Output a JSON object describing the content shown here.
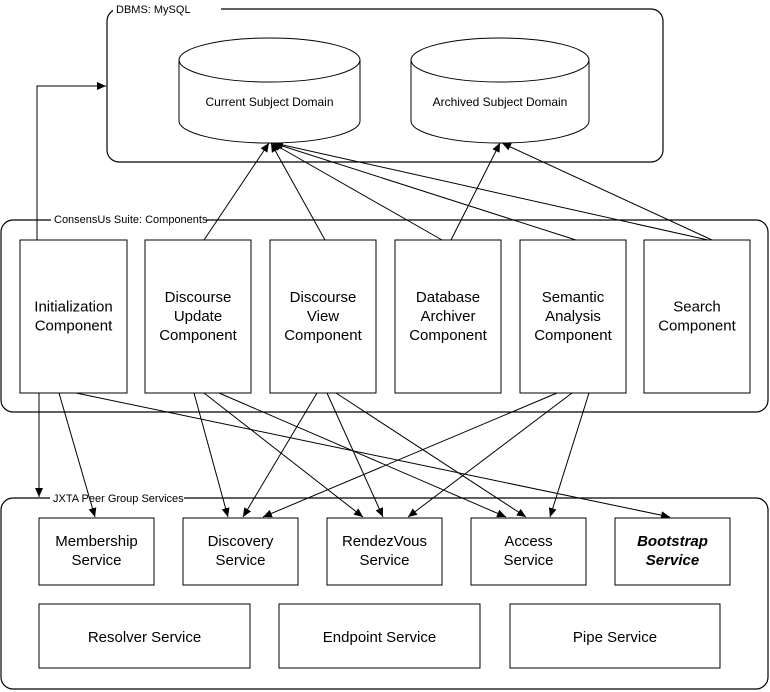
{
  "groups": {
    "dbms": "DBMS: MySQL",
    "components": "ConsensUs Suite: Components",
    "services": "JXTA Peer Group Services"
  },
  "databases": [
    {
      "id": "current",
      "label": "Current Subject Domain"
    },
    {
      "id": "archived",
      "label": "Archived Subject Domain"
    }
  ],
  "components": [
    {
      "id": "init",
      "lines": [
        "Initialization",
        "Component"
      ]
    },
    {
      "id": "du",
      "lines": [
        "Discourse",
        "Update",
        "Component"
      ]
    },
    {
      "id": "dv",
      "lines": [
        "Discourse",
        "View",
        "Component"
      ]
    },
    {
      "id": "da",
      "lines": [
        "Database",
        "Archiver",
        "Component"
      ]
    },
    {
      "id": "sa",
      "lines": [
        "Semantic",
        "Analysis",
        "Component"
      ]
    },
    {
      "id": "search",
      "lines": [
        "Search",
        "Component"
      ]
    }
  ],
  "services": [
    {
      "id": "membership",
      "lines": [
        "Membership",
        "Service"
      ]
    },
    {
      "id": "discovery",
      "lines": [
        "Discovery",
        "Service"
      ]
    },
    {
      "id": "rendezvous",
      "lines": [
        "RendezVous",
        "Service"
      ]
    },
    {
      "id": "access",
      "lines": [
        "Access",
        "Service"
      ]
    },
    {
      "id": "bootstrap",
      "lines": [
        "Bootstrap",
        "Service"
      ],
      "bold_italic": true
    }
  ],
  "core_services": [
    {
      "id": "resolver",
      "label": "Resolver Service"
    },
    {
      "id": "endpoint",
      "label": "Endpoint Service"
    },
    {
      "id": "pipe",
      "label": "Pipe Service"
    }
  ],
  "connections": [
    [
      "init",
      "dbms"
    ],
    [
      "init",
      "services"
    ],
    [
      "du",
      "current"
    ],
    [
      "dv",
      "current"
    ],
    [
      "da",
      "current"
    ],
    [
      "da",
      "archived"
    ],
    [
      "sa",
      "current"
    ],
    [
      "search",
      "current"
    ],
    [
      "search",
      "archived"
    ],
    [
      "init",
      "membership"
    ],
    [
      "init",
      "bootstrap"
    ],
    [
      "du",
      "discovery"
    ],
    [
      "du",
      "rendezvous"
    ],
    [
      "du",
      "access"
    ],
    [
      "dv",
      "discovery"
    ],
    [
      "dv",
      "rendezvous"
    ],
    [
      "dv",
      "access"
    ],
    [
      "sa",
      "discovery"
    ],
    [
      "sa",
      "rendezvous"
    ],
    [
      "sa",
      "access"
    ]
  ]
}
